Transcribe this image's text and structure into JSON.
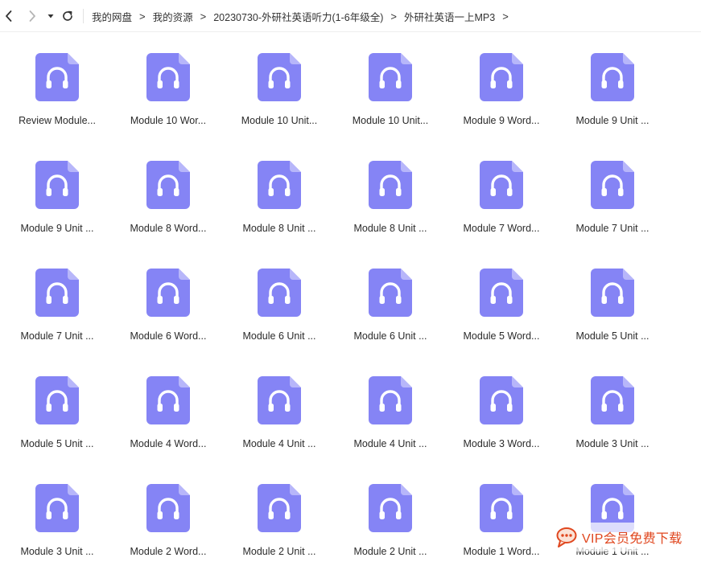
{
  "toolbar": {
    "back_icon": "chevron-left-icon",
    "forward_icon": "chevron-right-icon",
    "history_icon": "caret-down-icon",
    "refresh_icon": "refresh-icon"
  },
  "breadcrumb": {
    "items": [
      "我的网盘",
      "我的资源",
      "20230730-外研社英语听力(1-6年级全)",
      "外研社英语一上MP3"
    ],
    "separator": ">"
  },
  "file_icon": {
    "type": "audio-file-icon",
    "color": "#8584F5",
    "fold_color": "#B7B6FA"
  },
  "files": [
    "Review Module...",
    "Module 10 Wor...",
    "Module 10 Unit...",
    "Module 10 Unit...",
    "Module 9 Word...",
    "Module 9 Unit ...",
    "Module 9 Unit ...",
    "Module 8 Word...",
    "Module 8 Unit ...",
    "Module 8 Unit ...",
    "Module 7 Word...",
    "Module 7 Unit ...",
    "Module 7 Unit ...",
    "Module 6 Word...",
    "Module 6 Unit ...",
    "Module 6 Unit ...",
    "Module 5 Word...",
    "Module 5 Unit ...",
    "Module 5 Unit ...",
    "Module 4 Word...",
    "Module 4 Unit ...",
    "Module 4 Unit ...",
    "Module 3 Word...",
    "Module 3 Unit ...",
    "Module 3 Unit ...",
    "Module 2 Word...",
    "Module 2 Unit ...",
    "Module 2 Unit ...",
    "Module 1 Word...",
    "Module 1 Unit ..."
  ],
  "watermark": {
    "text": "VIP会员免费下载",
    "icon": "chat-bubble-icon",
    "color": "#E0471F"
  }
}
